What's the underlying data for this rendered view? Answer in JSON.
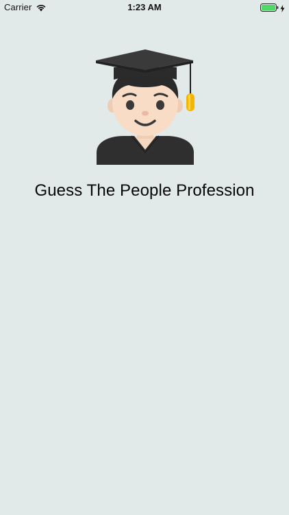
{
  "status_bar": {
    "carrier": "Carrier",
    "time": "1:23 AM",
    "icons": [
      "wifi-icon",
      "battery-icon",
      "charging-bolt-icon"
    ],
    "battery_color": "#4cd964"
  },
  "main": {
    "hero_icon": "student-graduate-icon",
    "title": "Guess The People Profession"
  },
  "colors": {
    "background": "#e2e9e9",
    "text": "#050505"
  }
}
